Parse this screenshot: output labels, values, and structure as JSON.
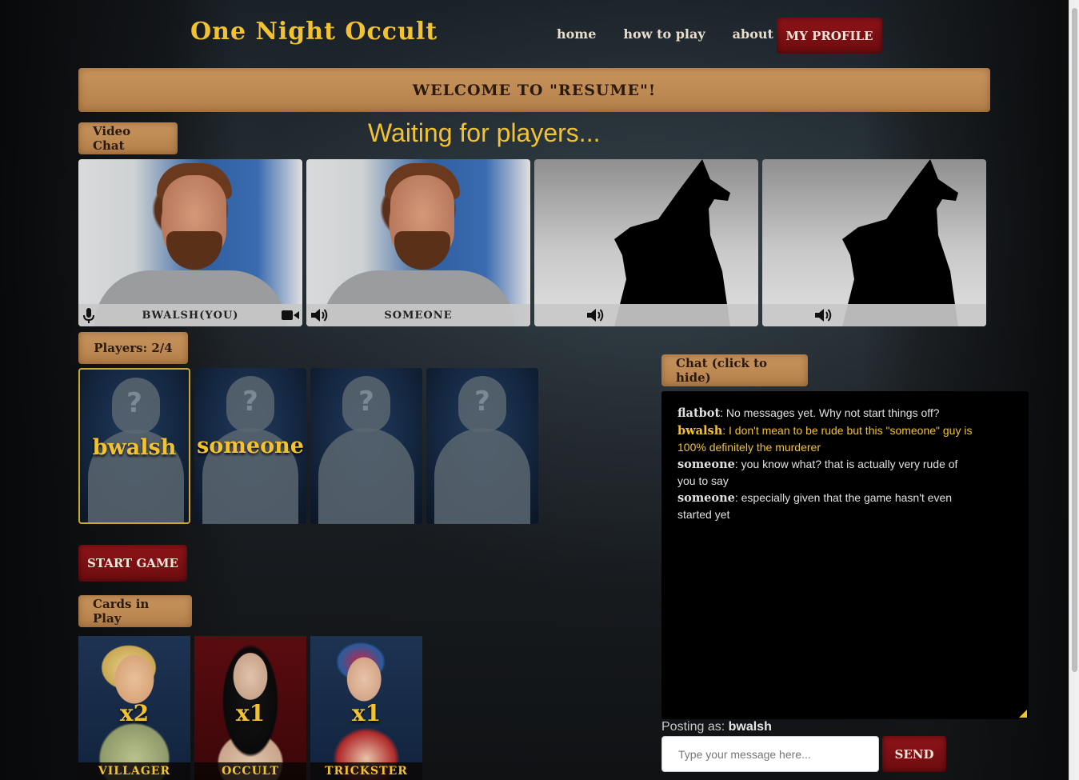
{
  "header": {
    "logo": "One Night Occult",
    "nav": [
      "home",
      "how to play",
      "about"
    ],
    "profile_button": "MY PROFILE"
  },
  "welcome_banner": "WELCOME TO \"RESUME\"!",
  "video_section": {
    "label": "Video Chat",
    "status": "Waiting for players...",
    "feeds": [
      {
        "name": "BWALSH(YOU)",
        "type": "camera",
        "mic_icon": "microphone-icon",
        "cam_icon": "video-camera-icon"
      },
      {
        "name": "SOMEONE",
        "type": "camera",
        "audio_icon": "speaker-icon"
      },
      {
        "name": "",
        "type": "placeholder-wolf",
        "audio_icon": "speaker-icon"
      },
      {
        "name": "",
        "type": "placeholder-wolf",
        "audio_icon": "speaker-icon"
      }
    ]
  },
  "players": {
    "label": "Players: 2/4",
    "slots": [
      {
        "name": "bwalsh",
        "active": true
      },
      {
        "name": "someone",
        "active": false
      },
      {
        "name": "",
        "active": false
      },
      {
        "name": "",
        "active": false
      }
    ]
  },
  "start_button": "START GAME",
  "cards_in_play": {
    "label": "Cards in Play",
    "cards": [
      {
        "name": "VILLAGER",
        "count": "x2"
      },
      {
        "name": "OCCULT",
        "count": "x1"
      },
      {
        "name": "TRICKSTER",
        "count": "x1"
      }
    ]
  },
  "chat": {
    "label": "Chat (click to hide)",
    "messages": [
      {
        "who": "flatbot",
        "text": ": No messages yet. Why not start things off?",
        "yours": false
      },
      {
        "who": "bwalsh",
        "text": ": I don't mean to be rude but this \"someone\" guy is 100% definitely the murderer",
        "yours": true
      },
      {
        "who": "someone",
        "text": ": you know what? that is actually very rude of you to say",
        "yours": false
      },
      {
        "who": "someone",
        "text": ": especially given that the game hasn't even started yet",
        "yours": false
      }
    ],
    "posting_as_label": "Posting as:",
    "posting_as_user": "bwalsh",
    "input_placeholder": "Type your message here...",
    "send_button": "SEND"
  },
  "colors": {
    "accent_gold": "#f2c230",
    "button_red": "#8e1418",
    "parchment": "#c9955e"
  }
}
